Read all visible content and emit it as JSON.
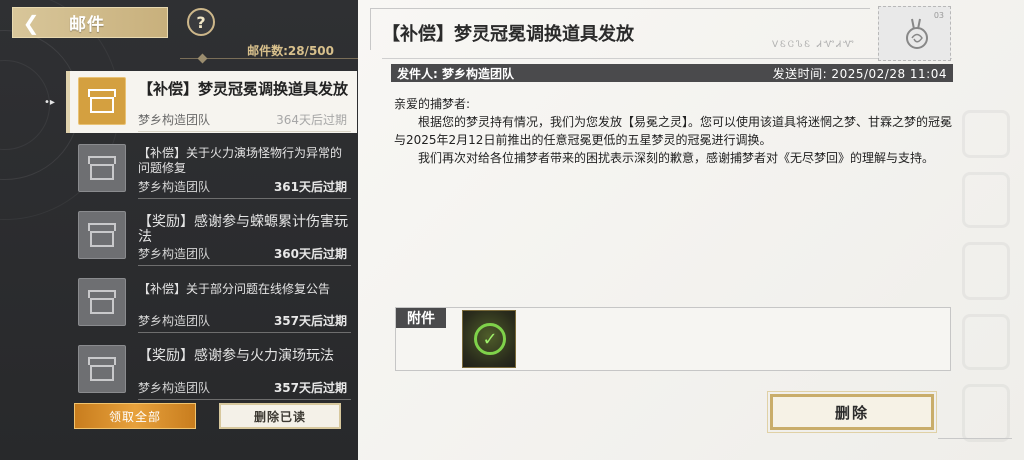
{
  "header": {
    "title": "邮件",
    "help_label": "?",
    "mail_count": "邮件数:28/500"
  },
  "mail_list": [
    {
      "title": "【补偿】梦灵冠冕调换道具发放",
      "sender": "梦乡构造团队",
      "expire": "364天后过期",
      "selected": true
    },
    {
      "title": "【补偿】关于火力演场怪物行为异常的问题修复",
      "sender": "梦乡构造团队",
      "expire": "361天后过期",
      "selected": false
    },
    {
      "title": "【奖励】感谢参与蝾螈累计伤害玩法",
      "sender": "梦乡构造团队",
      "expire": "360天后过期",
      "selected": false
    },
    {
      "title": "【补偿】关于部分问题在线修复公告",
      "sender": "梦乡构造团队",
      "expire": "357天后过期",
      "selected": false
    },
    {
      "title": "【奖励】感谢参与火力演场玩法",
      "sender": "梦乡构造团队",
      "expire": "357天后过期",
      "selected": false
    }
  ],
  "actions": {
    "claim_all": "领取全部",
    "delete_read": "删除已读"
  },
  "detail": {
    "subject": "【补偿】梦灵冠冕调换道具发放",
    "stamp_number": "03",
    "stamp_script": "ᐯᏋᏣᏖᏋ ᏗᏉᏗᏉ",
    "sender_label": "发件人: 梦乡构造团队",
    "send_time": "发送时间:   2025/02/28 11:04",
    "greeting": "亲爱的捕梦者:",
    "paragraph1": "根据您的梦灵持有情况，我们为您发放【易冕之灵】。您可以使用该道具将迷惘之梦、甘霖之梦的冠冕与2025年2月12日前推出的任意冠冕更低的五星梦灵的冠冕进行调换。",
    "paragraph2": "我们再次对给各位捕梦者带来的困扰表示深刻的歉意，感谢捕梦者对《无尽梦回》的理解与支持。",
    "attachment_label": "附件",
    "delete_label": "删除"
  },
  "colors": {
    "accent_gold": "#c8b07c",
    "selected_icon": "#d4a040",
    "claim_orange": "#e7a13c",
    "dark_bar": "#4a4a4c"
  }
}
